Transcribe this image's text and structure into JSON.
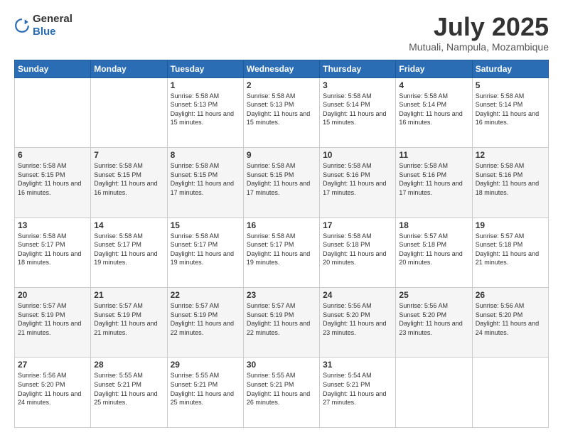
{
  "header": {
    "logo_general": "General",
    "logo_blue": "Blue",
    "month_title": "July 2025",
    "location": "Mutuali, Nampula, Mozambique"
  },
  "weekdays": [
    "Sunday",
    "Monday",
    "Tuesday",
    "Wednesday",
    "Thursday",
    "Friday",
    "Saturday"
  ],
  "weeks": [
    [
      {
        "day": "",
        "info": ""
      },
      {
        "day": "",
        "info": ""
      },
      {
        "day": "1",
        "info": "Sunrise: 5:58 AM\nSunset: 5:13 PM\nDaylight: 11 hours and 15 minutes."
      },
      {
        "day": "2",
        "info": "Sunrise: 5:58 AM\nSunset: 5:13 PM\nDaylight: 11 hours and 15 minutes."
      },
      {
        "day": "3",
        "info": "Sunrise: 5:58 AM\nSunset: 5:14 PM\nDaylight: 11 hours and 15 minutes."
      },
      {
        "day": "4",
        "info": "Sunrise: 5:58 AM\nSunset: 5:14 PM\nDaylight: 11 hours and 16 minutes."
      },
      {
        "day": "5",
        "info": "Sunrise: 5:58 AM\nSunset: 5:14 PM\nDaylight: 11 hours and 16 minutes."
      }
    ],
    [
      {
        "day": "6",
        "info": "Sunrise: 5:58 AM\nSunset: 5:15 PM\nDaylight: 11 hours and 16 minutes."
      },
      {
        "day": "7",
        "info": "Sunrise: 5:58 AM\nSunset: 5:15 PM\nDaylight: 11 hours and 16 minutes."
      },
      {
        "day": "8",
        "info": "Sunrise: 5:58 AM\nSunset: 5:15 PM\nDaylight: 11 hours and 17 minutes."
      },
      {
        "day": "9",
        "info": "Sunrise: 5:58 AM\nSunset: 5:15 PM\nDaylight: 11 hours and 17 minutes."
      },
      {
        "day": "10",
        "info": "Sunrise: 5:58 AM\nSunset: 5:16 PM\nDaylight: 11 hours and 17 minutes."
      },
      {
        "day": "11",
        "info": "Sunrise: 5:58 AM\nSunset: 5:16 PM\nDaylight: 11 hours and 17 minutes."
      },
      {
        "day": "12",
        "info": "Sunrise: 5:58 AM\nSunset: 5:16 PM\nDaylight: 11 hours and 18 minutes."
      }
    ],
    [
      {
        "day": "13",
        "info": "Sunrise: 5:58 AM\nSunset: 5:17 PM\nDaylight: 11 hours and 18 minutes."
      },
      {
        "day": "14",
        "info": "Sunrise: 5:58 AM\nSunset: 5:17 PM\nDaylight: 11 hours and 19 minutes."
      },
      {
        "day": "15",
        "info": "Sunrise: 5:58 AM\nSunset: 5:17 PM\nDaylight: 11 hours and 19 minutes."
      },
      {
        "day": "16",
        "info": "Sunrise: 5:58 AM\nSunset: 5:17 PM\nDaylight: 11 hours and 19 minutes."
      },
      {
        "day": "17",
        "info": "Sunrise: 5:58 AM\nSunset: 5:18 PM\nDaylight: 11 hours and 20 minutes."
      },
      {
        "day": "18",
        "info": "Sunrise: 5:57 AM\nSunset: 5:18 PM\nDaylight: 11 hours and 20 minutes."
      },
      {
        "day": "19",
        "info": "Sunrise: 5:57 AM\nSunset: 5:18 PM\nDaylight: 11 hours and 21 minutes."
      }
    ],
    [
      {
        "day": "20",
        "info": "Sunrise: 5:57 AM\nSunset: 5:19 PM\nDaylight: 11 hours and 21 minutes."
      },
      {
        "day": "21",
        "info": "Sunrise: 5:57 AM\nSunset: 5:19 PM\nDaylight: 11 hours and 21 minutes."
      },
      {
        "day": "22",
        "info": "Sunrise: 5:57 AM\nSunset: 5:19 PM\nDaylight: 11 hours and 22 minutes."
      },
      {
        "day": "23",
        "info": "Sunrise: 5:57 AM\nSunset: 5:19 PM\nDaylight: 11 hours and 22 minutes."
      },
      {
        "day": "24",
        "info": "Sunrise: 5:56 AM\nSunset: 5:20 PM\nDaylight: 11 hours and 23 minutes."
      },
      {
        "day": "25",
        "info": "Sunrise: 5:56 AM\nSunset: 5:20 PM\nDaylight: 11 hours and 23 minutes."
      },
      {
        "day": "26",
        "info": "Sunrise: 5:56 AM\nSunset: 5:20 PM\nDaylight: 11 hours and 24 minutes."
      }
    ],
    [
      {
        "day": "27",
        "info": "Sunrise: 5:56 AM\nSunset: 5:20 PM\nDaylight: 11 hours and 24 minutes."
      },
      {
        "day": "28",
        "info": "Sunrise: 5:55 AM\nSunset: 5:21 PM\nDaylight: 11 hours and 25 minutes."
      },
      {
        "day": "29",
        "info": "Sunrise: 5:55 AM\nSunset: 5:21 PM\nDaylight: 11 hours and 25 minutes."
      },
      {
        "day": "30",
        "info": "Sunrise: 5:55 AM\nSunset: 5:21 PM\nDaylight: 11 hours and 26 minutes."
      },
      {
        "day": "31",
        "info": "Sunrise: 5:54 AM\nSunset: 5:21 PM\nDaylight: 11 hours and 27 minutes."
      },
      {
        "day": "",
        "info": ""
      },
      {
        "day": "",
        "info": ""
      }
    ]
  ]
}
